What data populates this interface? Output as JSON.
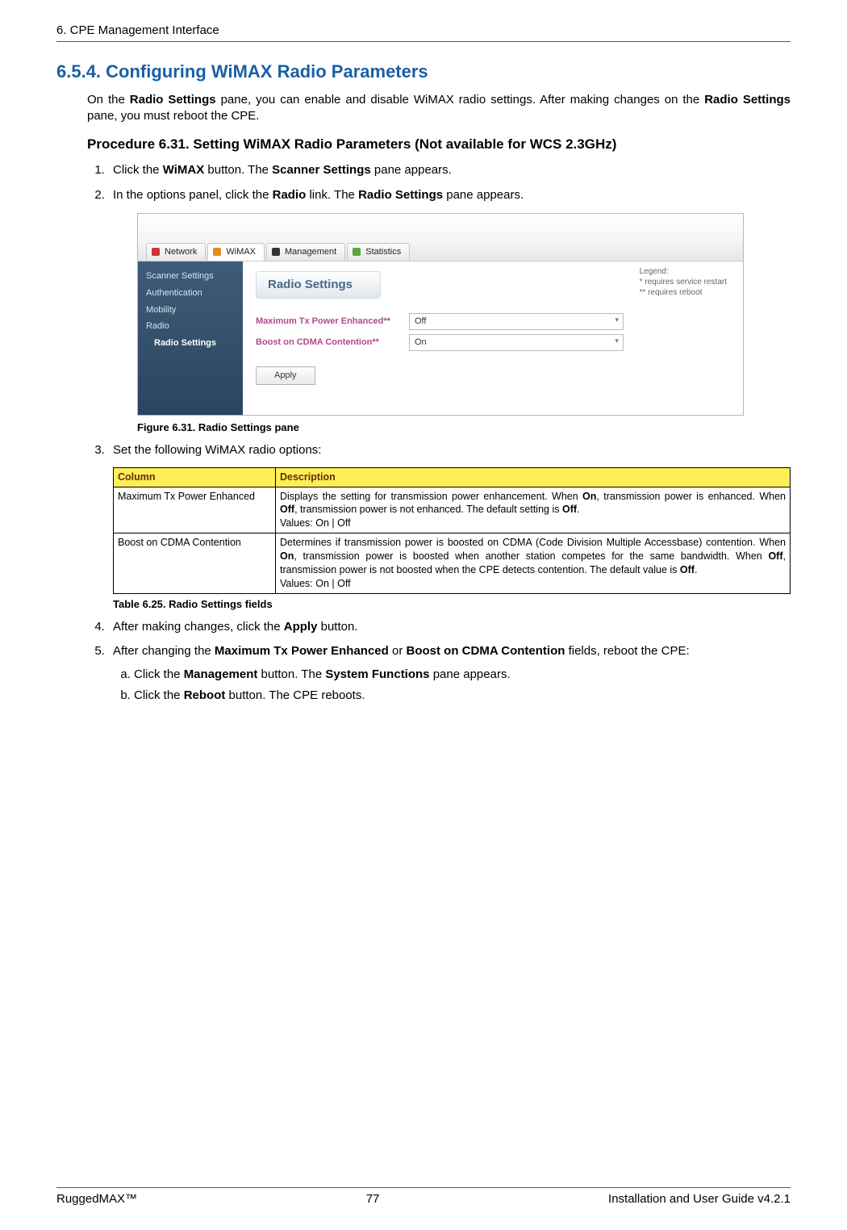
{
  "header": {
    "left": "6. CPE Management Interface"
  },
  "section": {
    "number_title": "6.5.4. Configuring WiMAX Radio Parameters",
    "intro_pre": "On the ",
    "intro_b1": "Radio Settings",
    "intro_mid1": " pane, you can enable and disable WiMAX radio settings. After making changes on the ",
    "intro_b2": "Radio Settings",
    "intro_post": " pane, you must reboot the CPE.",
    "procedure_title": "Procedure 6.31. Setting WiMAX Radio Parameters (Not available for WCS 2.3GHz)"
  },
  "steps": {
    "s1_a": "Click the ",
    "s1_b1": "WiMAX",
    "s1_b": " button. The ",
    "s1_b2": "Scanner Settings",
    "s1_c": " pane appears.",
    "s2_a": "In the options panel, click the ",
    "s2_b1": "Radio",
    "s2_b": " link. The ",
    "s2_b2": "Radio Settings",
    "s2_c": " pane appears.",
    "s3": "Set the following WiMAX radio options:",
    "s4_a": "After making changes, click the ",
    "s4_b1": "Apply",
    "s4_b": " button.",
    "s5_a": "After changing the ",
    "s5_b1": "Maximum Tx Power Enhanced",
    "s5_b": " or ",
    "s5_b2": "Boost on CDMA Contention",
    "s5_c": " fields, reboot the CPE:",
    "s5a_a": "Click the ",
    "s5a_b1": "Management",
    "s5a_b": " button. The ",
    "s5a_b2": "System Functions",
    "s5a_c": " pane appears.",
    "s5b_a": "Click the ",
    "s5b_b1": "Reboot",
    "s5b_b": " button. The CPE reboots."
  },
  "screenshot": {
    "tabs": [
      "Network",
      "WiMAX",
      "Management",
      "Statistics"
    ],
    "side": {
      "items": [
        "Scanner Settings",
        "Authentication",
        "Mobility",
        "Radio"
      ],
      "sub": "Radio Settings"
    },
    "title": "Radio Settings",
    "legend_title": "Legend:",
    "legend_l1": "*   requires service restart",
    "legend_l2": "** requires reboot",
    "rows": [
      {
        "label": "Maximum Tx Power Enhanced**",
        "value": "Off"
      },
      {
        "label": "Boost on CDMA Contention**",
        "value": "On"
      }
    ],
    "apply": "Apply"
  },
  "fig_caption": "Figure 6.31. Radio Settings pane",
  "table": {
    "h1": "Column",
    "h2": "Description",
    "r1c1": "Maximum Tx Power Enhanced",
    "r1c2_a": "Displays the setting for transmission power enhancement. When ",
    "r1c2_b1": "On",
    "r1c2_b": ", transmission power is enhanced. When ",
    "r1c2_b2": "Off",
    "r1c2_c": ", transmission power is not enhanced. The default setting is ",
    "r1c2_b3": "Off",
    "r1c2_d": ".",
    "r1c2_v": "Values: On | Off",
    "r2c1": "Boost on CDMA Contention",
    "r2c2_a": "Determines if transmission power is boosted on CDMA (Code Division Multiple Accessbase) contention. When ",
    "r2c2_b1": "On",
    "r2c2_b": ", transmission power is boosted when another station competes for the same bandwidth. When ",
    "r2c2_b2": "Off",
    "r2c2_c": ", transmission power is not boosted when the CPE detects contention. The default value is ",
    "r2c2_b3": "Off",
    "r2c2_d": ".",
    "r2c2_v": "Values: On | Off"
  },
  "tbl_caption": "Table 6.25. Radio Settings fields",
  "footer": {
    "left": "RuggedMAX™",
    "center": "77",
    "right": "Installation and User Guide v4.2.1"
  }
}
